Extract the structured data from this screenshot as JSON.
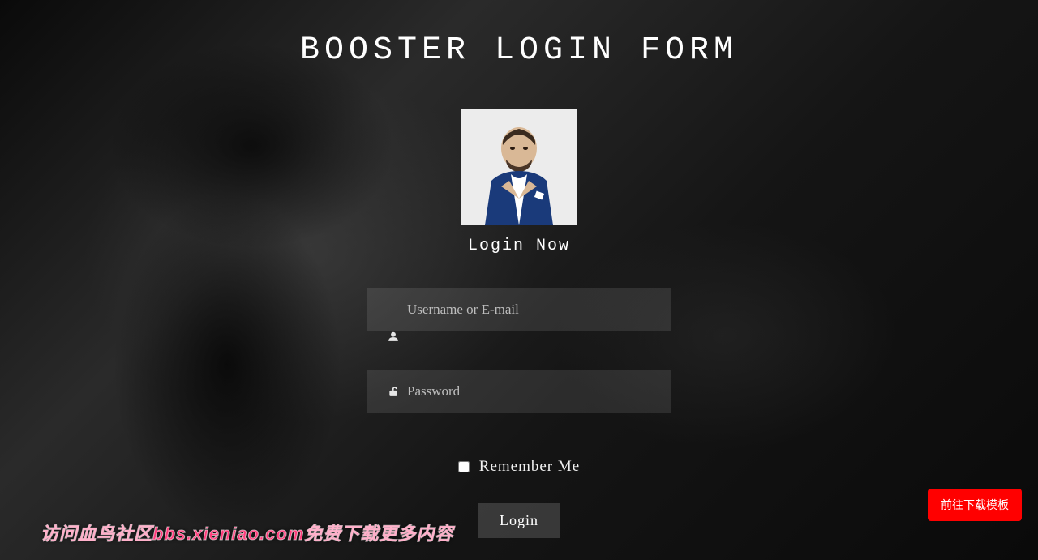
{
  "page": {
    "title": "BOOSTER LOGIN FORM"
  },
  "login": {
    "subtitle": "Login Now",
    "username_placeholder": "Username or E-mail",
    "password_placeholder": "Password",
    "remember_label": "Remember Me",
    "submit_label": "Login"
  },
  "download_button": {
    "label": "前往下载模板"
  },
  "watermark": {
    "text": "访问血鸟社区bbs.xieniao.com免费下载更多内容"
  }
}
